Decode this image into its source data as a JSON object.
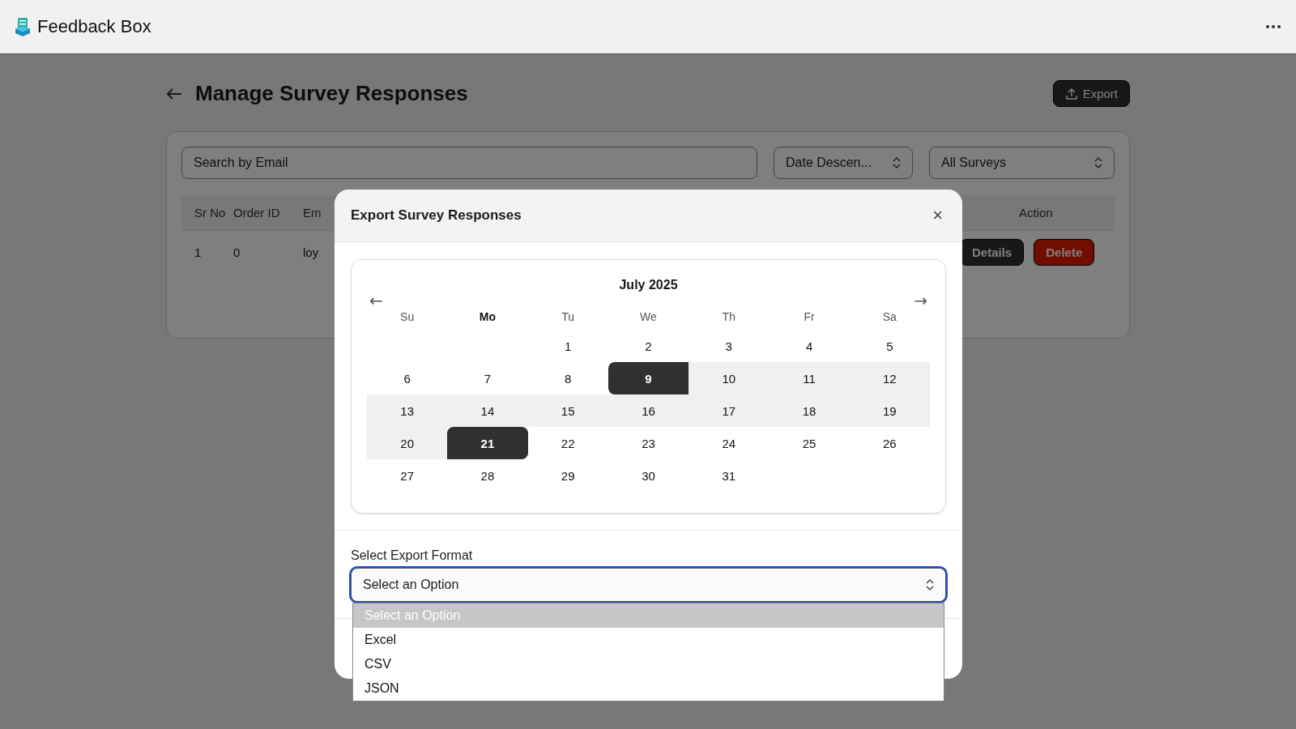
{
  "app": {
    "title": "Feedback Box"
  },
  "page": {
    "title": "Manage Survey Responses",
    "export_button": "Export"
  },
  "filters": {
    "search": {
      "placeholder": "Search by Email"
    },
    "sort": {
      "value": "Date Descen..."
    },
    "survey": {
      "value": "All Surveys"
    }
  },
  "table": {
    "columns": [
      "Sr No",
      "Order ID",
      "Em",
      "Action"
    ],
    "rows": [
      {
        "sr_no": "1",
        "order_id": "0",
        "email": "loy",
        "actions": [
          {
            "label": "Details",
            "kind": "details"
          },
          {
            "label": "Delete",
            "kind": "delete"
          }
        ]
      }
    ]
  },
  "modal": {
    "title": "Export Survey Responses",
    "close": "×",
    "calendar": {
      "month": "July 2025",
      "prev": "←",
      "next": "→",
      "weekdays": [
        {
          "label": "Su",
          "today": false
        },
        {
          "label": "Mo",
          "today": true
        },
        {
          "label": "Tu",
          "today": false
        },
        {
          "label": "We",
          "today": false
        },
        {
          "label": "Th",
          "today": false
        },
        {
          "label": "Fr",
          "today": false
        },
        {
          "label": "Sa",
          "today": false
        }
      ],
      "weeks": [
        [
          {
            "day": "1",
            "selected": false,
            "in_range": false
          },
          {
            "day": "2",
            "selected": false,
            "in_range": false
          },
          {
            "day": "3",
            "selected": false,
            "in_range": false
          },
          {
            "day": "4",
            "selected": false,
            "in_range": false
          },
          {
            "day": "5",
            "selected": false,
            "in_range": false
          }
        ],
        [
          {
            "day": "6",
            "selected": false,
            "in_range": false
          },
          {
            "day": "7",
            "selected": false,
            "in_range": false
          },
          {
            "day": "8",
            "selected": false,
            "in_range": false
          },
          {
            "day": "9",
            "selected": true,
            "in_range": true
          },
          {
            "day": "10",
            "selected": false,
            "in_range": true
          },
          {
            "day": "11",
            "selected": false,
            "in_range": true
          },
          {
            "day": "12",
            "selected": false,
            "in_range": true
          }
        ],
        [
          {
            "day": "13",
            "selected": false,
            "in_range": true
          },
          {
            "day": "14",
            "selected": false,
            "in_range": true
          },
          {
            "day": "15",
            "selected": false,
            "in_range": true
          },
          {
            "day": "16",
            "selected": false,
            "in_range": true
          },
          {
            "day": "17",
            "selected": false,
            "in_range": true
          },
          {
            "day": "18",
            "selected": false,
            "in_range": true
          },
          {
            "day": "19",
            "selected": false,
            "in_range": true
          }
        ],
        [
          {
            "day": "20",
            "selected": false,
            "in_range": true
          },
          {
            "day": "21",
            "selected": true,
            "in_range": true
          },
          {
            "day": "22",
            "selected": false,
            "in_range": false
          },
          {
            "day": "23",
            "selected": false,
            "in_range": false
          },
          {
            "day": "24",
            "selected": false,
            "in_range": false
          },
          {
            "day": "25",
            "selected": false,
            "in_range": false
          },
          {
            "day": "26",
            "selected": false,
            "in_range": false
          }
        ],
        [
          {
            "day": "27",
            "selected": false,
            "in_range": false
          },
          {
            "day": "28",
            "selected": false,
            "in_range": false
          },
          {
            "day": "29",
            "selected": false,
            "in_range": false
          },
          {
            "day": "30",
            "selected": false,
            "in_range": false
          },
          {
            "day": "31",
            "selected": false,
            "in_range": false
          }
        ]
      ]
    },
    "format": {
      "label": "Select Export Format",
      "value": "Select an Option",
      "focused": true,
      "options": [
        {
          "label": "Select an Option",
          "selected": true
        },
        {
          "label": "Excel",
          "selected": false
        },
        {
          "label": "CSV",
          "selected": false
        },
        {
          "label": "JSON",
          "selected": false
        }
      ]
    }
  }
}
